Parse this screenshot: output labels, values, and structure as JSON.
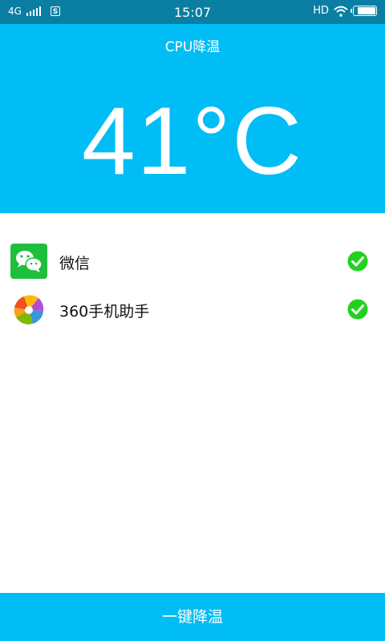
{
  "status_bar": {
    "network": "4G",
    "sim_label": "S",
    "time": "15:07",
    "hd_label": "HD",
    "battery_level": 0.9
  },
  "header": {
    "title": "CPU降温",
    "temperature": "41°C"
  },
  "apps": [
    {
      "name": "微信",
      "icon": "wechat-icon",
      "checked": true
    },
    {
      "name": "360手机助手",
      "icon": "360-assistant-icon",
      "checked": true
    }
  ],
  "bottom_button": {
    "label": "一键降温"
  },
  "colors": {
    "status_bar": "#0a7fa3",
    "accent": "#00bdf5",
    "check": "#22d11e",
    "wechat": "#1fbf3d"
  }
}
